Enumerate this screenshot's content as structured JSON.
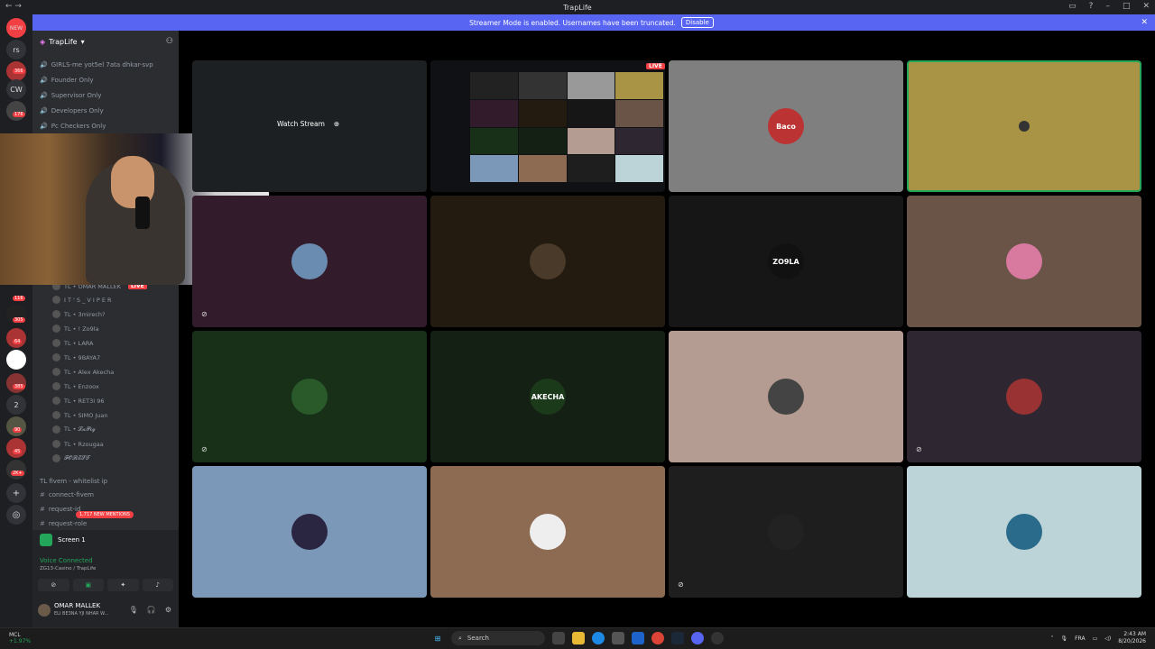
{
  "titlebar": {
    "title": "TrapLife"
  },
  "banner": {
    "text": "Streamer Mode is enabled. Usernames have been truncated.",
    "disable_label": "Disable"
  },
  "rail": {
    "items": [
      {
        "label": "NEW",
        "badge": ""
      },
      {
        "label": "rs",
        "badge": ""
      },
      {
        "label": "",
        "badge": "366"
      },
      {
        "label": "CW",
        "badge": ""
      },
      {
        "label": "",
        "badge": "176"
      },
      {
        "label": "",
        "badge": "116"
      },
      {
        "label": "",
        "badge": "305"
      },
      {
        "label": "",
        "badge": "64"
      },
      {
        "label": "",
        "badge": "385"
      },
      {
        "label": "2",
        "badge": ""
      },
      {
        "label": "",
        "badge": "90"
      },
      {
        "label": "",
        "badge": "45"
      },
      {
        "label": "",
        "badge": "2K+"
      }
    ]
  },
  "sidebar": {
    "guild_name": "TrapLife",
    "top_channels": [
      "GIRLS-me yot5el 7ata dhkar-svp",
      "Founder Only",
      "Supervisor Only",
      "Developers Only",
      "Pc Checkers Only"
    ],
    "voice_users": [
      "TL • OMAR MALLEK",
      "I T ' S _ V I P E R",
      "TL • 3mirech?",
      "TL • ! Zo9la",
      "TL • LARA",
      "TL • 9BAYA7",
      "TL • Alex Akecha",
      "TL • Enzoox",
      "TL • RET3I 96",
      "TL • SIMO Juan",
      "TL • 𝓛𝓪𝓟𝓲𝓰",
      "TL • Rzougaa",
      "𝓕𝓞𝓡𝓔𝓢𝓣"
    ],
    "category": "TL fivem - whitelist ip",
    "bottom_channels": [
      "connect-fivem",
      "request-id",
      "request-role"
    ],
    "new_mentions": "1,717 NEW MENTIONS"
  },
  "panel": {
    "screen_label": "Screen 1",
    "voice_status": "Voice Connected",
    "voice_channel": "ZG13-Casino / TrapLife",
    "username": "OMAR MALLEK",
    "user_status": "ELI BE3NA YJI NHAR W..."
  },
  "stage": {
    "watch_stream": "Watch Stream",
    "live_label": "LIVE",
    "tiles": [
      {
        "bg": "#1d2022",
        "label": ""
      },
      {
        "bg": "#0f1115",
        "label": ""
      },
      {
        "bg": "#7f7f7f",
        "label": "Baco"
      },
      {
        "bg": "#a99446",
        "label": ""
      },
      {
        "bg": "#321b2a",
        "label": ""
      },
      {
        "bg": "#231a10",
        "label": ""
      },
      {
        "bg": "#161616",
        "label": "ZO9LA"
      },
      {
        "bg": "#6a5448",
        "label": ""
      },
      {
        "bg": "#173017",
        "label": ""
      },
      {
        "bg": "#152015",
        "label": "AKECHA"
      },
      {
        "bg": "#b59c92",
        "label": ""
      },
      {
        "bg": "#2e2631",
        "label": ""
      },
      {
        "bg": "#7b98b8",
        "label": ""
      },
      {
        "bg": "#8d6b53",
        "label": ""
      },
      {
        "bg": "#1e1e1e",
        "label": ""
      },
      {
        "bg": "#bcd4d8",
        "label": ""
      }
    ]
  },
  "taskbar": {
    "weather_temp": "MCL",
    "weather_change": "+1.97%",
    "search_label": "Search",
    "lang": "FRA",
    "time": "2:43 AM",
    "date": "8/20/2026"
  }
}
